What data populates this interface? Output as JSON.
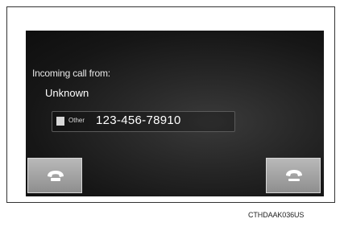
{
  "incoming_call": {
    "title": "Incoming call from:",
    "caller": "Unknown",
    "phone_type": "Other",
    "number": "123-456-78910"
  },
  "buttons": {
    "answer_icon": "phone-answer-icon",
    "reject_icon": "phone-hangup-icon"
  },
  "caption": "CTHDAAK036US"
}
